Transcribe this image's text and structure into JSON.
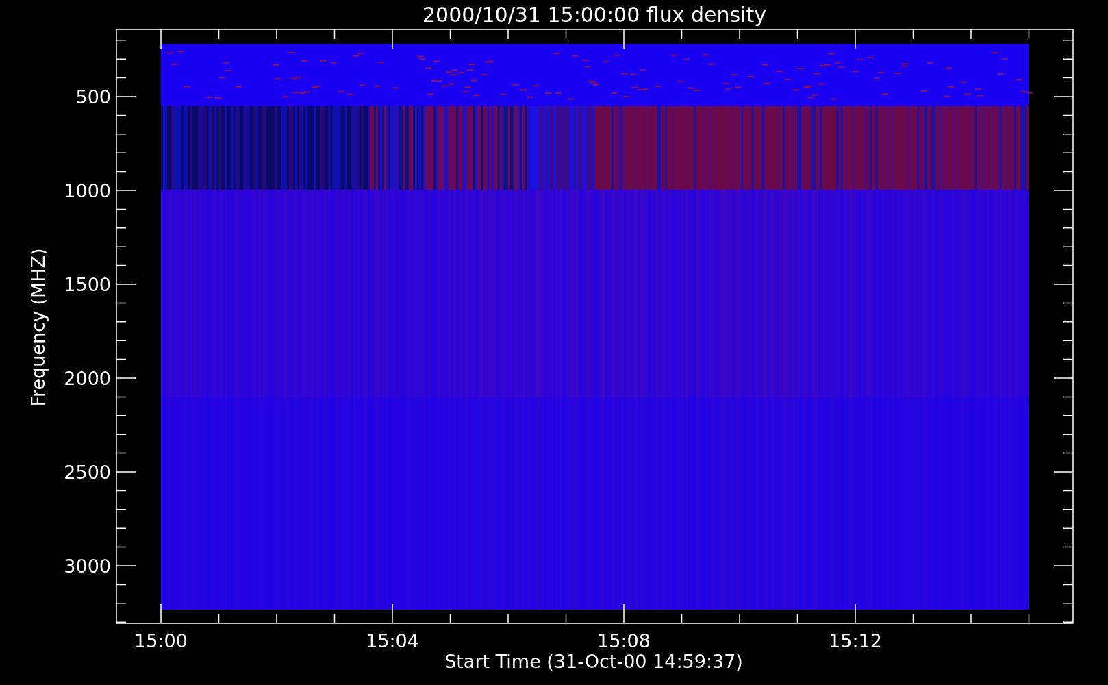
{
  "title": "2000/10/31 15:00:00 flux density",
  "y_axis": {
    "label": "Frequency (MHZ)",
    "ticks": [
      "500",
      "1000",
      "1500",
      "2000",
      "2500",
      "3000"
    ]
  },
  "x_axis": {
    "label": "Start Time (31-Oct-00 14:59:37)",
    "ticks": [
      "15:00",
      "15:04",
      "15:08",
      "15:12"
    ]
  }
}
